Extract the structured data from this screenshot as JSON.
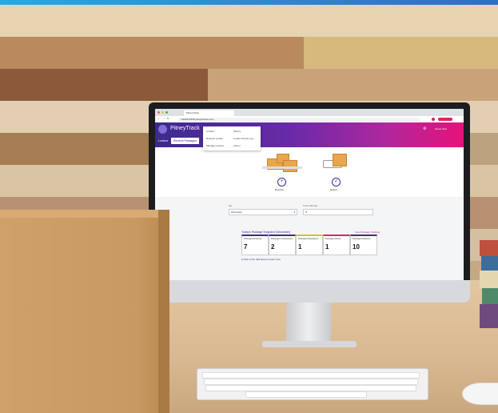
{
  "browser": {
    "tab_title": "PitneyTrack",
    "url": "Track371630.pitneybowes.com"
  },
  "app": {
    "brand": "PitneyTrack",
    "nav": [
      "Lockers",
      "Receiving"
    ],
    "user_name": "Guest User",
    "colors": {
      "primary": "#3b2a8f",
      "accent": "#e6127a"
    }
  },
  "sidebar": {
    "items": [
      "Lockers",
      "Receive Packages"
    ]
  },
  "dropdown": {
    "col1": [
      "Lockers",
      "Reserve Locker",
      "Manage Lockers"
    ],
    "col2": [
      "History",
      "Locker Activity Log",
      "Admin"
    ]
  },
  "actions": [
    {
      "label": "Receive",
      "icon": "plus-icon"
    },
    {
      "label": "Deliver",
      "icon": "check-icon"
    }
  ],
  "search": {
    "site_label": "Site",
    "site_value": "Worcester",
    "tracking_label": "Track a Barcode",
    "tracking_placeholder": ""
  },
  "snapshot": {
    "title": "Today's Package Snapshot (Worcester)",
    "link": "View Package Tracking",
    "cards": [
      {
        "label": "Packages Received",
        "value": "7",
        "color": "#3b2a8f"
      },
      {
        "label": "Packages Checkpointed",
        "value": "2",
        "color": "#3b2a8f"
      },
      {
        "label": "Packages Reassigned",
        "value": "1",
        "color": "#f0b429"
      },
      {
        "label": "Packages Moved",
        "value": "1",
        "color": "#e0245e"
      },
      {
        "label": "Packages Delivered",
        "value": "10",
        "color": "#3b2a8f"
      }
    ],
    "info": "Click on the data above to learn more"
  }
}
